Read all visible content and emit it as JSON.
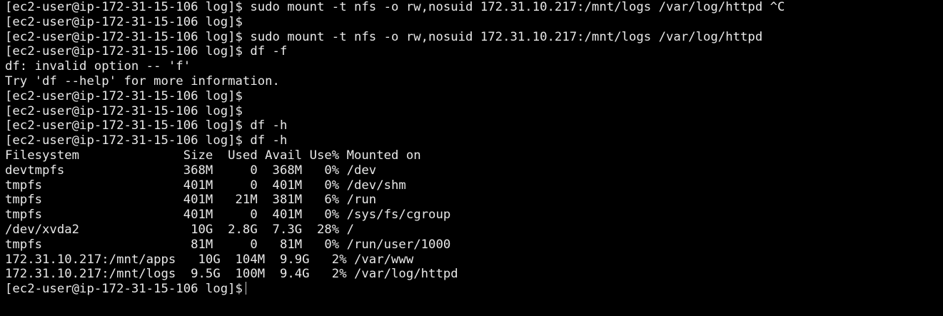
{
  "terminal": {
    "lines": [
      "[ec2-user@ip-172-31-15-106 log]$ sudo mount -t nfs -o rw,nosuid 172.31.10.217:/mnt/logs /var/log/httpd ^C",
      "[ec2-user@ip-172-31-15-106 log]$",
      "[ec2-user@ip-172-31-15-106 log]$ sudo mount -t nfs -o rw,nosuid 172.31.10.217:/mnt/logs /var/log/httpd",
      "[ec2-user@ip-172-31-15-106 log]$ df -f",
      "df: invalid option -- 'f'",
      "Try 'df --help' for more information.",
      "[ec2-user@ip-172-31-15-106 log]$",
      "[ec2-user@ip-172-31-15-106 log]$",
      "[ec2-user@ip-172-31-15-106 log]$ df -h",
      "[ec2-user@ip-172-31-15-106 log]$ df -h",
      "Filesystem              Size  Used Avail Use% Mounted on",
      "devtmpfs                368M     0  368M   0% /dev",
      "tmpfs                   401M     0  401M   0% /dev/shm",
      "tmpfs                   401M   21M  381M   6% /run",
      "tmpfs                   401M     0  401M   0% /sys/fs/cgroup",
      "/dev/xvda2               10G  2.8G  7.3G  28% /",
      "tmpfs                    81M     0   81M   0% /run/user/1000",
      "172.31.10.217:/mnt/apps   10G  104M  9.9G   2% /var/www",
      "172.31.10.217:/mnt/logs  9.5G  100M  9.4G   2% /var/log/httpd"
    ],
    "current_prompt": "[ec2-user@ip-172-31-15-106 log]$",
    "colors": {
      "background": "#000000",
      "foreground": "#e8e8e8"
    }
  }
}
